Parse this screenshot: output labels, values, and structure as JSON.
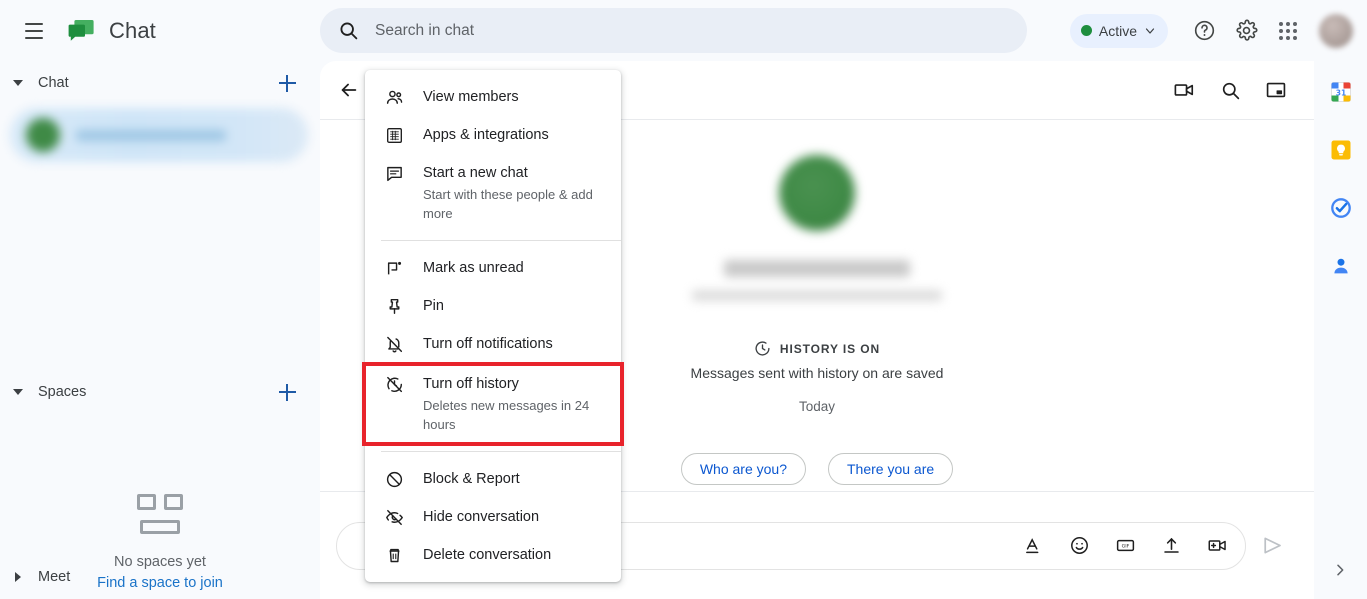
{
  "app": {
    "title": "Chat",
    "logo_icon": "google-chat-logo"
  },
  "topbar": {
    "menu_icon": "hamburger-menu-icon",
    "search": {
      "icon": "search-icon",
      "placeholder": "Search in chat",
      "value": ""
    },
    "status": {
      "label": "Active",
      "dot_color": "#1e8e3e",
      "chevron_icon": "chevron-down-icon"
    },
    "help_icon": "help-circle-icon",
    "settings_icon": "gear-icon",
    "apps_icon": "apps-grid-icon",
    "avatar_icon": "user-avatar"
  },
  "sidebar": {
    "chat_section": {
      "title": "Chat",
      "caret_icon": "caret-down-icon",
      "add_icon": "plus-icon",
      "items": [
        {
          "name": "",
          "redacted": true
        }
      ]
    },
    "spaces_section": {
      "title": "Spaces",
      "caret_icon": "caret-down-icon",
      "add_icon": "plus-icon",
      "empty_icon": "spaces-grid-icon",
      "empty_title": "No spaces yet",
      "empty_link": "Find a space to join"
    },
    "meet_section": {
      "title": "Meet",
      "caret_icon": "caret-right-icon"
    }
  },
  "conversation": {
    "back_icon": "back-arrow-icon",
    "header_actions": [
      {
        "icon": "video-camera-icon",
        "name": "start-video-call"
      },
      {
        "icon": "search-icon",
        "name": "search-in-conversation"
      },
      {
        "icon": "open-in-new-window-icon",
        "name": "open-in-new-window"
      }
    ],
    "partner_name": "",
    "partner_subtitle": "",
    "history": {
      "icon": "history-clock-icon",
      "label": "HISTORY IS ON",
      "note": "Messages sent with history on are saved"
    },
    "day_divider": "Today",
    "suggestion_chips": [
      "Who are you?",
      "There you are"
    ],
    "composer": {
      "placeholder": "",
      "value": "",
      "tools": [
        {
          "icon": "format-text-icon",
          "name": "format-options"
        },
        {
          "icon": "emoji-icon",
          "name": "insert-emoji"
        },
        {
          "icon": "gif-icon",
          "name": "insert-gif"
        },
        {
          "icon": "upload-icon",
          "name": "upload-file"
        },
        {
          "icon": "add-video-icon",
          "name": "add-video-meeting"
        }
      ],
      "send_icon": "send-icon"
    }
  },
  "context_menu": {
    "groups": [
      {
        "items": [
          {
            "icon": "people-icon",
            "label": "View members",
            "desc": ""
          },
          {
            "icon": "apps-integrations-icon",
            "label": "Apps & integrations",
            "desc": ""
          },
          {
            "icon": "new-chat-icon",
            "label": "Start a new chat",
            "desc": "Start with these people & add more"
          }
        ]
      },
      {
        "items": [
          {
            "icon": "mark-unread-icon",
            "label": "Mark as unread",
            "desc": ""
          },
          {
            "icon": "pin-icon",
            "label": "Pin",
            "desc": ""
          },
          {
            "icon": "notifications-off-icon",
            "label": "Turn off notifications",
            "desc": ""
          },
          {
            "icon": "history-off-icon",
            "label": "Turn off history",
            "desc": "Deletes new messages in 24 hours",
            "highlighted": true
          }
        ]
      },
      {
        "items": [
          {
            "icon": "block-icon",
            "label": "Block & Report",
            "desc": ""
          },
          {
            "icon": "hide-eye-icon",
            "label": "Hide conversation",
            "desc": ""
          },
          {
            "icon": "trash-icon",
            "label": "Delete conversation",
            "desc": ""
          }
        ]
      }
    ],
    "highlight_color": "#e8232b"
  },
  "right_rail": {
    "items": [
      {
        "icon": "google-calendar-icon",
        "name": "calendar"
      },
      {
        "icon": "google-keep-icon",
        "name": "keep"
      },
      {
        "icon": "google-tasks-icon",
        "name": "tasks"
      },
      {
        "icon": "google-contacts-icon",
        "name": "contacts"
      }
    ],
    "expand_icon": "chevron-right-icon"
  }
}
